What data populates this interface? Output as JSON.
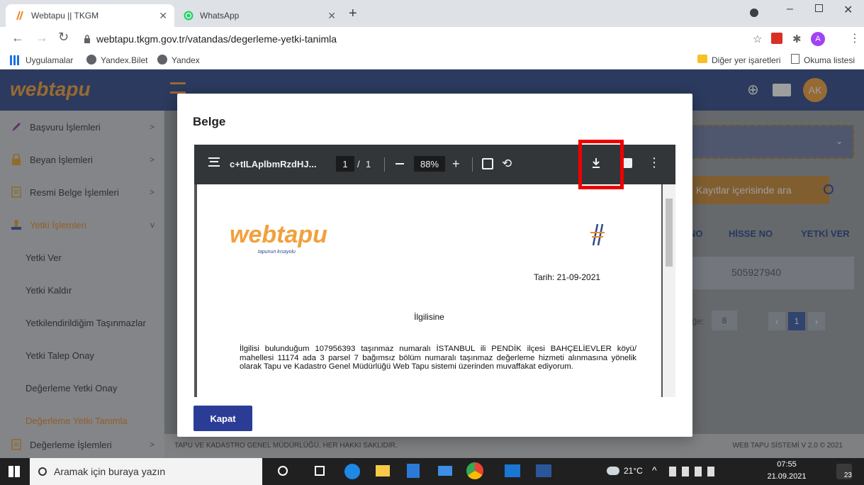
{
  "browser": {
    "tabs": [
      {
        "title": "Webtapu || TKGM"
      },
      {
        "title": "WhatsApp"
      }
    ],
    "url": "webtapu.tkgm.gov.tr/vatandas/degerleme-yetki-tanimla",
    "bookmarks": [
      "Uygulamalar",
      "Yandex.Bilet",
      "Yandex"
    ],
    "bookmarks_right": [
      "Diğer yer işaretleri",
      "Okuma listesi"
    ],
    "profile_initial": "A"
  },
  "app": {
    "logo": "webtapu",
    "user_initials": "AK",
    "sidebar": [
      {
        "label": "Başvuru İşlemleri",
        "icon": "edit-icon",
        "chev": ">"
      },
      {
        "label": "Beyan İşlemleri",
        "icon": "lock-icon",
        "chev": ">"
      },
      {
        "label": "Resmi Belge İşlemleri",
        "icon": "document-icon",
        "chev": ">"
      },
      {
        "label": "Yetki İşlemleri",
        "icon": "stamp-icon",
        "chev": "v"
      },
      {
        "label": "Yetki Ver"
      },
      {
        "label": "Yetki Kaldır"
      },
      {
        "label": "Yetkilendirildiğim Taşınmazlar"
      },
      {
        "label": "Yetki Talep Onay"
      },
      {
        "label": "Değerleme Yetki Onay"
      },
      {
        "label": "Değerleme Yetki Tanımla"
      },
      {
        "label": "Değerleme İşlemleri",
        "icon": "document-icon",
        "chev": ">"
      }
    ],
    "search_placeholder": "Kayıtlar içerisinde ara",
    "table_headers": [
      "NO",
      "HİSSE NO",
      "YETKİ VER"
    ],
    "table_value": "505927940",
    "page_size_label": "öğe:",
    "page_size": "8",
    "current_page": "1",
    "footer_left": "TAPU VE KADASTRO GENEL MÜDÜRLÜĞÜ, HER HAKKI SAKLIDIR.",
    "footer_right": "WEB TAPU SİSTEMİ V 2.0 © 2021"
  },
  "modal": {
    "title": "Belge",
    "close_label": "Kapat",
    "pdf": {
      "filename": "c+tILAplbmRzdHJ...",
      "page_current": "1",
      "page_sep": "/",
      "page_total": "1",
      "zoom": "88%",
      "doc_logo": "webtapu",
      "doc_logo_tagline": "tapunun kısayolu",
      "date": "Tarih: 21-09-2021",
      "heading": "İlgilisine",
      "body": "İlgilisi bulunduğum 107956393 taşınmaz numaralı İSTANBUL ili PENDİK ilçesi BAHÇELİEVLER köyü/ mahellesi 11174 ada 3 parsel 7 bağımsız bölüm numaralı taşınmaz değerleme hizmeti alınmasına yönelik olarak Tapu ve Kadastro Genel Müdürlüğü Web Tapu sistemi üzerinden muvaffakat ediyorum."
    }
  },
  "taskbar": {
    "search_placeholder": "Aramak için buraya yazın",
    "temperature": "21°C",
    "time": "07:55",
    "date": "21.09.2021",
    "notification_count": "23"
  },
  "colors": {
    "app_header": "#2f4a8b",
    "accent_orange": "#f2a03d",
    "close_button": "#2b3c97",
    "highlight": "#ee0000"
  }
}
